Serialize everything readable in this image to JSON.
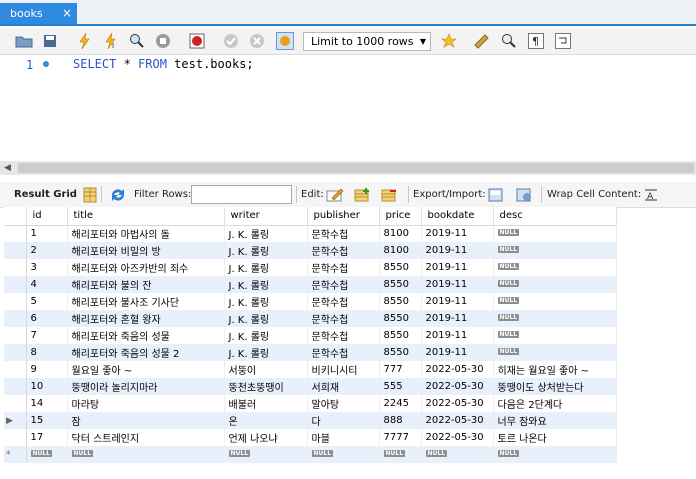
{
  "tab": {
    "label": "books",
    "close": "×"
  },
  "toolbar": {
    "limit_label": "Limit to 1000 rows"
  },
  "editor": {
    "line_number": "1",
    "kw_select": "SELECT",
    "star": " * ",
    "kw_from": "FROM",
    "rest": " test.books;"
  },
  "results": {
    "result_grid": "Result Grid",
    "filter_rows": "Filter Rows:",
    "edit": "Edit:",
    "export_import": "Export/Import:",
    "wrap_cell": "Wrap Cell Content:"
  },
  "grid": {
    "columns": [
      "id",
      "title",
      "writer",
      "publisher",
      "price",
      "bookdate",
      "desc"
    ],
    "null_label": "NULL",
    "rows": [
      {
        "id": "1",
        "title": "해리포터와 마법사의 돌",
        "writer": "J. K. 롤링",
        "publisher": "문학수첩",
        "price": "8100",
        "bookdate": "2019-11",
        "desc": null
      },
      {
        "id": "2",
        "title": "해리포터와 비밀의 방",
        "writer": "J. K. 롤링",
        "publisher": "문학수첩",
        "price": "8100",
        "bookdate": "2019-11",
        "desc": null
      },
      {
        "id": "3",
        "title": "해리포터와 아즈카반의 죄수",
        "writer": "J. K. 롤링",
        "publisher": "문학수첩",
        "price": "8550",
        "bookdate": "2019-11",
        "desc": null
      },
      {
        "id": "4",
        "title": "해리포터와 불의 잔",
        "writer": "J. K. 롤링",
        "publisher": "문학수첩",
        "price": "8550",
        "bookdate": "2019-11",
        "desc": null
      },
      {
        "id": "5",
        "title": "해리포터와 불사조 기사단",
        "writer": "J. K. 롤링",
        "publisher": "문학수첩",
        "price": "8550",
        "bookdate": "2019-11",
        "desc": null
      },
      {
        "id": "6",
        "title": "해리포터와 혼혈 왕자",
        "writer": "J. K. 롤링",
        "publisher": "문학수첩",
        "price": "8550",
        "bookdate": "2019-11",
        "desc": null
      },
      {
        "id": "7",
        "title": "해리포터와 죽음의 성물",
        "writer": "J. K. 롤링",
        "publisher": "문학수첩",
        "price": "8550",
        "bookdate": "2019-11",
        "desc": null
      },
      {
        "id": "8",
        "title": "해리포터와 죽음의 성물 2",
        "writer": "J. K. 롤링",
        "publisher": "문학수첩",
        "price": "8550",
        "bookdate": "2019-11",
        "desc": null
      },
      {
        "id": "9",
        "title": "월요일 좋아 ~",
        "writer": "서뚱이",
        "publisher": "비키니시티",
        "price": "777",
        "bookdate": "2022-05-30",
        "desc": "히재는 월요일 좋아 ~"
      },
      {
        "id": "10",
        "title": "뚱땡이라 놀리지마라",
        "writer": "뚱천초뚱땡이",
        "publisher": "서희재",
        "price": "555",
        "bookdate": "2022-05-30",
        "desc": "뚱땡이도 상처받는다"
      },
      {
        "id": "14",
        "title": "마라탕",
        "writer": "배불러",
        "publisher": "말아탕",
        "price": "2245",
        "bookdate": "2022-05-30",
        "desc": "다음은 2단계다"
      },
      {
        "id": "15",
        "title": "잠",
        "writer": "온",
        "publisher": "다",
        "price": "888",
        "bookdate": "2022-05-30",
        "desc": "너무 잠와요"
      },
      {
        "id": "17",
        "title": "닥터 스트레인지",
        "writer": "언제 나오냐",
        "publisher": "마블",
        "price": "7777",
        "bookdate": "2022-05-30",
        "desc": "토르 나온다"
      }
    ],
    "new_row_marker": "*",
    "current_row_marker": "▶"
  }
}
